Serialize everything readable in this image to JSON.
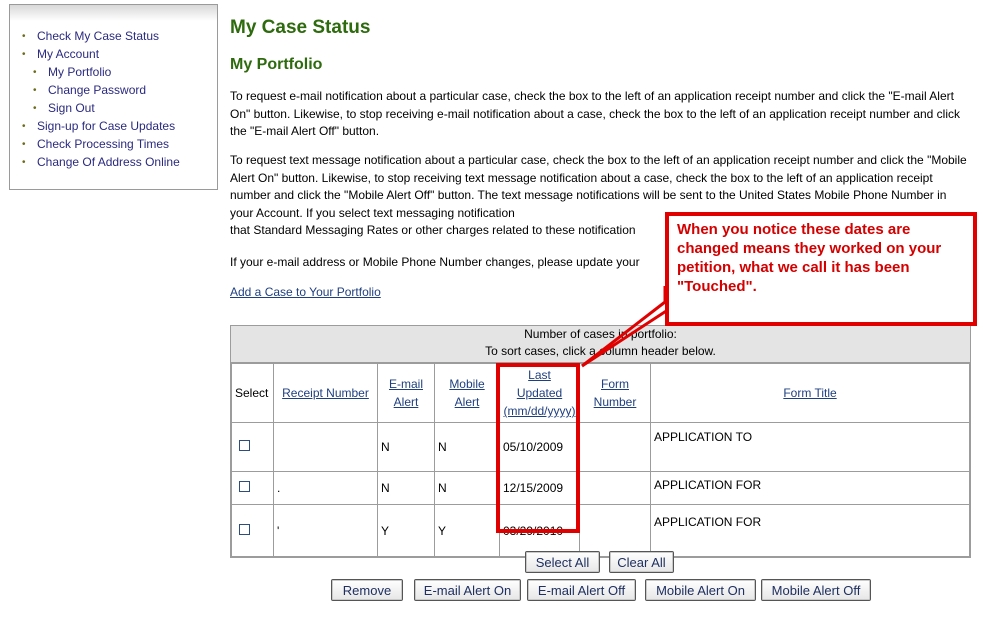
{
  "sidebar": {
    "items": [
      {
        "label": "Check My Case Status",
        "sub": false
      },
      {
        "label": "My Account",
        "sub": false
      },
      {
        "label": "My Portfolio",
        "sub": true
      },
      {
        "label": "Change Password",
        "sub": true
      },
      {
        "label": "Sign Out",
        "sub": true
      },
      {
        "label": "Sign-up for Case Updates",
        "sub": false
      },
      {
        "label": "Check Processing Times",
        "sub": false
      },
      {
        "label": "Change Of Address Online",
        "sub": false
      }
    ]
  },
  "page": {
    "title": "My Case Status",
    "subtitle": "My Portfolio",
    "para1": "To request e-mail notification about a particular case, check the box to the left of an application receipt number and click the \"E-mail Alert On\" button. Likewise, to stop receiving e-mail notification about a case, check the box to the left of an application receipt number and click the \"E-mail Alert Off\" button.",
    "para2": "To request text message notification about a particular case, check the box to the left of an application receipt number and click the \"Mobile Alert On\" button. Likewise, to stop receiving text message notification about a case, check the box to the left of an application receipt number and click the \"Mobile Alert Off\" button. The text message notifications will be sent to the United States Mobile Phone Number in your Account. If you select text messaging notification",
    "para2b": "that Standard Messaging Rates or other charges related to these notification",
    "para3": "If your e-mail address or Mobile Phone Number changes, please update your",
    "add_case_link": "Add a Case to Your Portfolio"
  },
  "portfolio": {
    "count_label": "Number of cases in portfolio:",
    "sort_hint": "To sort cases, click a column header below.",
    "headers": {
      "select": "Select",
      "receipt": "Receipt Number",
      "email_alert": [
        "E-mail",
        "Alert"
      ],
      "mobile_alert": [
        "Mobile",
        "Alert"
      ],
      "last_updated": [
        "Last",
        "Updated",
        "(mm/dd/yyyy)"
      ],
      "form_number": [
        "Form",
        "Number"
      ],
      "form_title": "Form Title"
    },
    "rows": [
      {
        "receipt": "",
        "email": "N",
        "mobile": "N",
        "updated": "05/10/2009",
        "form_number": "",
        "form_title": "APPLICATION TO"
      },
      {
        "receipt": ".",
        "email": "N",
        "mobile": "N",
        "updated": "12/15/2009",
        "form_number": "",
        "form_title": "APPLICATION FOR"
      },
      {
        "receipt": "'",
        "email": "Y",
        "mobile": "Y",
        "updated": "03/29/2010",
        "form_number": "",
        "form_title": "APPLICATION FOR"
      }
    ]
  },
  "buttons": {
    "select_all": "Select All",
    "clear_all": "Clear All",
    "remove": "Remove",
    "email_on": "E-mail Alert On",
    "email_off": "E-mail Alert Off",
    "mobile_on": "Mobile Alert On",
    "mobile_off": "Mobile Alert Off"
  },
  "annotation": {
    "text": "When you notice these dates are changed means they worked on your petition, what we call it has been \"Touched\".",
    "color": "#e00000"
  }
}
